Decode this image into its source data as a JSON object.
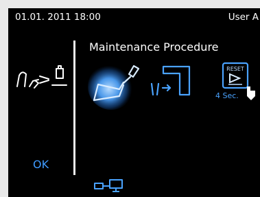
{
  "status": {
    "datetime": "01.01. 2011 18:00",
    "user": "User A"
  },
  "procedure": {
    "title": "Maintenance Procedure"
  },
  "actions": {
    "ok_label": "OK"
  },
  "steps": [
    {
      "icon": "handpiece-spray-icon",
      "state": "active"
    },
    {
      "icon": "handpiece-transfer-icon",
      "state": "inactive"
    },
    {
      "icon": "reset-icon",
      "badge": "RESET",
      "hold_time": "4 Sec."
    }
  ],
  "colors": {
    "background": "#000000",
    "accent": "#3f9bff",
    "text": "#ffffff"
  }
}
